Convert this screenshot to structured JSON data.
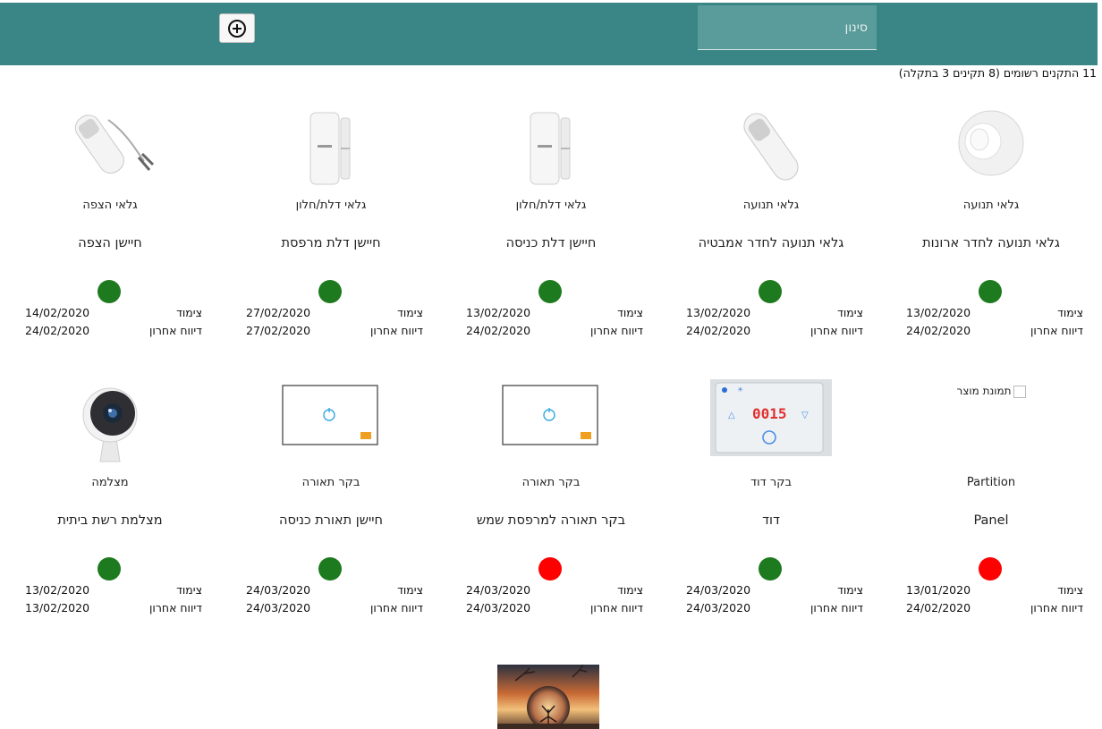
{
  "header": {
    "filter_placeholder": "סינון",
    "add_button": "add-circle-icon"
  },
  "summary": "11 התקנים רשומים (8 תקינים 3 בתקלה)",
  "labels": {
    "pairing": "צימוד",
    "last_report": "דיווח אחרון"
  },
  "colors": {
    "header": "#3a8585",
    "ok": "#1e7a1e",
    "fault": "#ff0000"
  },
  "devices": [
    {
      "type": "גלאי תנועה",
      "name": "גלאי תנועה לחדר ארונות",
      "status": "ok",
      "paired": "13/02/2020",
      "last": "24/02/2020",
      "image": "motion-sensor-round"
    },
    {
      "type": "גלאי תנועה",
      "name": "גלאי תנועה לחדר אמבטיה",
      "status": "ok",
      "paired": "13/02/2020",
      "last": "24/02/2020",
      "image": "motion-sensor"
    },
    {
      "type": "גלאי דלת/חלון",
      "name": "חיישן דלת כניסה",
      "status": "ok",
      "paired": "13/02/2020",
      "last": "24/02/2020",
      "image": "door-sensor"
    },
    {
      "type": "גלאי דלת/חלון",
      "name": "חיישן דלת מרפסת",
      "status": "ok",
      "paired": "27/02/2020",
      "last": "27/02/2020",
      "image": "door-sensor"
    },
    {
      "type": "גלאי הצפה",
      "name": "חיישן הצפה",
      "status": "ok",
      "paired": "14/02/2020",
      "last": "24/02/2020",
      "image": "flood-sensor"
    },
    {
      "type": "Partition",
      "name": "Panel",
      "status": "fault",
      "paired": "13/01/2020",
      "last": "24/02/2020",
      "image": "broken",
      "alt": "תמונת מוצר"
    },
    {
      "type": "בקר דוד",
      "name": "דוד",
      "status": "ok",
      "paired": "24/03/2020",
      "last": "24/03/2020",
      "image": "boiler-controller",
      "display": "00:15"
    },
    {
      "type": "בקר תאורה",
      "name": "בקר תאורה למרפסת שמש",
      "status": "fault",
      "paired": "24/03/2020",
      "last": "24/03/2020",
      "image": "light-switch"
    },
    {
      "type": "בקר תאורה",
      "name": "חיישן תאורת כניסה",
      "status": "ok",
      "paired": "24/03/2020",
      "last": "24/03/2020",
      "image": "light-switch"
    },
    {
      "type": "מצלמה",
      "name": "מצלמת רשת ביתית",
      "status": "ok",
      "paired": "13/02/2020",
      "last": "13/02/2020",
      "image": "camera"
    }
  ]
}
